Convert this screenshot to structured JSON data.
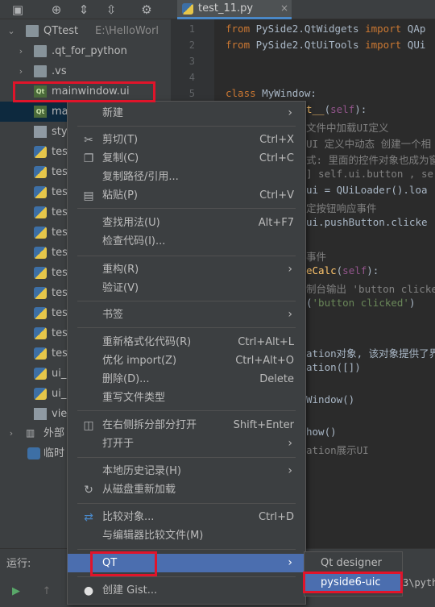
{
  "editor": {
    "tab": {
      "label": "test_11.py",
      "close": "×"
    },
    "line_numbers": [
      "1",
      "2",
      "3",
      "4",
      "5"
    ],
    "code": {
      "l1a": "from",
      "l1b": " PySide2.QtWidgets ",
      "l1c": "import",
      "l1d": " QAp",
      "l2a": "from",
      "l2b": " PySide2.QtUiTools ",
      "l2c": "import",
      "l2d": " QUi",
      "l5a": "class",
      "l5b": " MyWindow:",
      "l6a": "t__",
      "l6b": "(",
      "l6c": "self",
      "l6d": "):",
      "l7": "文件中加载UI定义",
      "l8": "UI 定义中动态 创建一个相",
      "l9": "式: 里面的控件对象也成为窗",
      "l10": "] self.ui.button , se",
      "l11": "ui = QUiLoader().loa",
      "l12": "定按钮响应事件",
      "l13": "ui.pushButton.clicke",
      "l15": "事件",
      "l16a": "eCalc",
      "l16b": "(",
      "l16c": "self",
      "l16d": "):",
      "l17": "制台输出 'button clicke",
      "l18a": "(",
      "l18b": "'button clicked'",
      "l18c": ")",
      "l21": "ation对象, 该对象提供了界",
      "l22": "ation([])",
      "l24": "Window()",
      "l26": "how()",
      "l27": "ation展示UI"
    }
  },
  "project_tree": {
    "root_label": "QTtest",
    "root_path": "E:\\HelloWorl",
    "items": [
      {
        "label": ".qt_for_python",
        "type": "folder"
      },
      {
        "label": ".vs",
        "type": "folder"
      },
      {
        "label": "mainwindow.ui",
        "type": "qt"
      },
      {
        "label": "mai",
        "type": "qt"
      },
      {
        "label": "sty",
        "type": "txt"
      },
      {
        "label": "tes",
        "type": "py"
      },
      {
        "label": "tes",
        "type": "py"
      },
      {
        "label": "tes",
        "type": "py"
      },
      {
        "label": "tes",
        "type": "py"
      },
      {
        "label": "tes",
        "type": "py"
      },
      {
        "label": "tes",
        "type": "py"
      },
      {
        "label": "tes",
        "type": "py"
      },
      {
        "label": "tes",
        "type": "py"
      },
      {
        "label": "tes",
        "type": "py"
      },
      {
        "label": "tes",
        "type": "py"
      },
      {
        "label": "tes",
        "type": "py"
      },
      {
        "label": "ui_",
        "type": "py"
      },
      {
        "label": "ui_",
        "type": "py"
      },
      {
        "label": "vie",
        "type": "txt"
      }
    ],
    "external_libs": "外部",
    "scratches": "临时"
  },
  "run_panel": {
    "title": "运行:",
    "output": "3\\pyth"
  },
  "context_menu": {
    "new": "新建",
    "cut": "剪切(T)",
    "cut_shortcut": "Ctrl+X",
    "copy": "复制(C)",
    "copy_shortcut": "Ctrl+C",
    "copy_path": "复制路径/引用...",
    "paste": "粘贴(P)",
    "paste_shortcut": "Ctrl+V",
    "find_usages": "查找用法(U)",
    "find_usages_shortcut": "Alt+F7",
    "inspect_code": "检查代码(I)...",
    "refactor": "重构(R)",
    "validate": "验证(V)",
    "bookmarks": "书签",
    "reformat": "重新格式化代码(R)",
    "reformat_shortcut": "Ctrl+Alt+L",
    "optimize_imports": "优化 import(Z)",
    "optimize_imports_shortcut": "Ctrl+Alt+O",
    "delete": "删除(D)...",
    "delete_shortcut": "Delete",
    "override_file_type": "重写文件类型",
    "split_right": "在右侧拆分部分打开",
    "split_right_shortcut": "Shift+Enter",
    "open_in": "打开于",
    "local_history": "本地历史记录(H)",
    "reload_from_disk": "从磁盘重新加载",
    "compare_with": "比较对象...",
    "compare_with_shortcut": "Ctrl+D",
    "compare_with_editor": "与编辑器比较文件(M)",
    "qt": "QT",
    "create_gist": "创建 Gist..."
  },
  "qt_submenu": {
    "designer": "Qt designer",
    "pyside6_uic": "pyside6-uic"
  },
  "colors": {
    "highlight": "#4b6eaf",
    "annotation_red": "#e0142a",
    "panel_bg": "#3c3f41",
    "editor_bg": "#2b2b2b"
  }
}
